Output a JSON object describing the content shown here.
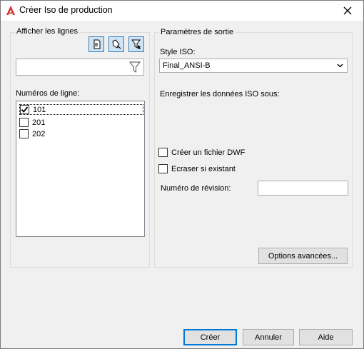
{
  "window": {
    "title": "Créer Iso de production",
    "accent_color": "#d22c2c"
  },
  "left_group": {
    "title": "Afficher les lignes",
    "toolbar": [
      "select-from-drawing-icon",
      "select-from-model-icon",
      "filter-select-icon"
    ],
    "filter_value": "",
    "list_label": "Numéros de ligne:",
    "lines": [
      {
        "label": "101",
        "checked": true
      },
      {
        "label": "201",
        "checked": false
      },
      {
        "label": "202",
        "checked": false
      }
    ]
  },
  "right_group": {
    "title": "Paramètres de sortie",
    "style_label": "Style ISO:",
    "style_value": "Final_ANSI-B",
    "save_label": "Enregistrer les données ISO sous:",
    "create_dwf": {
      "label": "Créer un fichier DWF",
      "checked": false
    },
    "overwrite": {
      "label": "Ecraser si existant",
      "checked": false
    },
    "revision_label": "Numéro de révision:",
    "revision_value": "",
    "advanced_button": "Options avancées..."
  },
  "footer": {
    "create": "Créer",
    "cancel": "Annuler",
    "help": "Aide"
  }
}
